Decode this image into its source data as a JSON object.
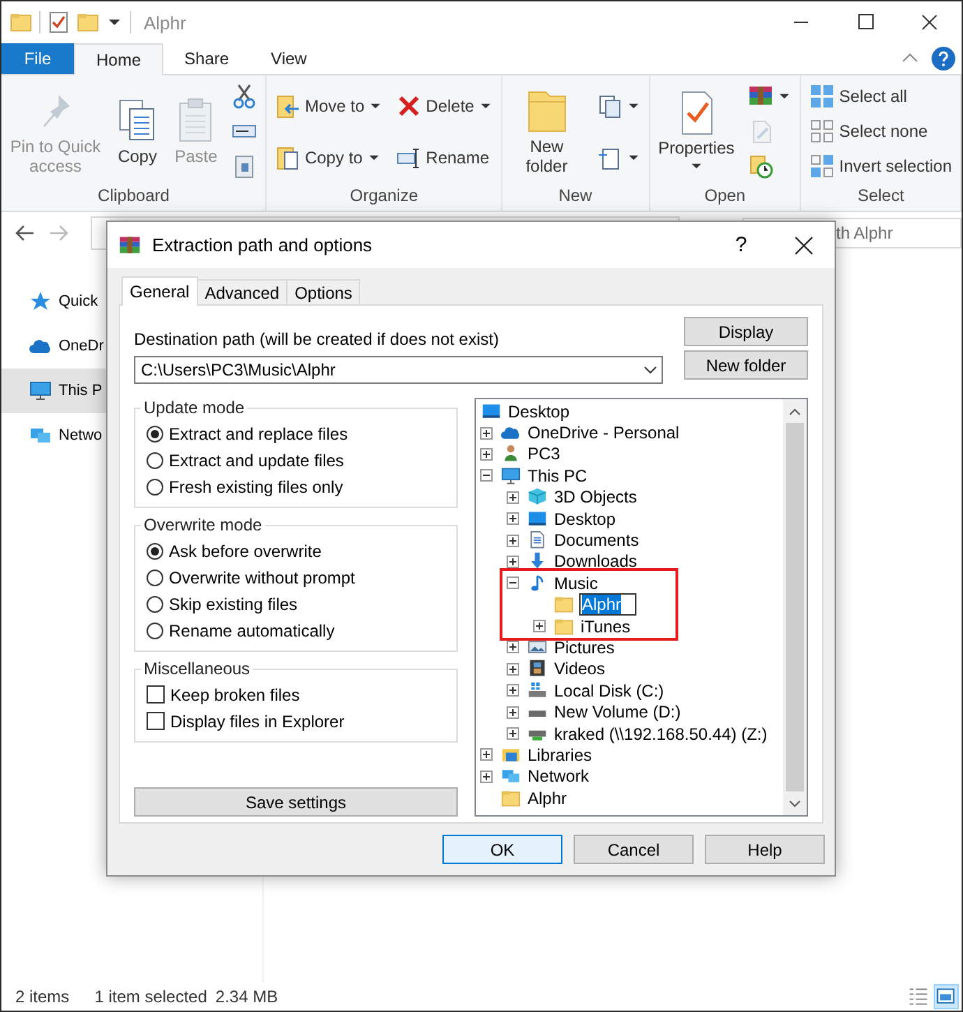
{
  "window": {
    "title": "Alphr"
  },
  "ribbon_tabs": [
    {
      "label": "File",
      "kind": "file",
      "selected": false
    },
    {
      "label": "Home",
      "kind": "tab",
      "selected": true
    },
    {
      "label": "Share",
      "kind": "tab",
      "selected": false
    },
    {
      "label": "View",
      "kind": "tab",
      "selected": false
    }
  ],
  "ribbon_groups": [
    {
      "label": "Clipboard",
      "columns": [
        [
          {
            "label": "Pin to Quick access",
            "kind": "pin",
            "disabled": true,
            "dropdown": false
          }
        ],
        [
          {
            "label": "Copy",
            "kind": "copy",
            "disabled": false,
            "dropdown": false
          }
        ],
        [
          {
            "label": "Paste",
            "kind": "paste",
            "disabled": true,
            "dropdown": false
          }
        ],
        [
          {
            "kind": "cut",
            "disabled": false,
            "dropdown": false
          },
          {
            "kind": "copy-path",
            "disabled": false,
            "dropdown": false
          },
          {
            "kind": "paste-shortcut",
            "disabled": false,
            "dropdown": false
          }
        ]
      ]
    },
    {
      "label": "Organize",
      "columns": [
        [
          {
            "label": "Move to",
            "kind": "move-to",
            "disabled": false,
            "dropdown": true
          },
          {
            "label": "Copy to",
            "kind": "copy-to",
            "disabled": false,
            "dropdown": true
          }
        ],
        [
          {
            "label": "Delete",
            "kind": "delete",
            "disabled": false,
            "dropdown": true
          },
          {
            "label": "Rename",
            "kind": "rename",
            "disabled": false,
            "dropdown": false
          }
        ]
      ]
    },
    {
      "label": "New",
      "columns": [
        [
          {
            "label": "New folder",
            "kind": "new-folder",
            "disabled": false,
            "dropdown": false
          }
        ],
        [
          {
            "kind": "new-item",
            "disabled": false,
            "dropdown": true
          },
          {
            "kind": "easy-access",
            "disabled": false,
            "dropdown": true
          }
        ]
      ]
    },
    {
      "label": "Open",
      "columns": [
        [
          {
            "label": "Properties",
            "kind": "properties",
            "disabled": false,
            "dropdown": true
          }
        ],
        [
          {
            "kind": "winrar",
            "disabled": false,
            "dropdown": true
          },
          {
            "kind": "edit",
            "disabled": true,
            "dropdown": false
          },
          {
            "kind": "history",
            "disabled": false,
            "dropdown": false
          }
        ]
      ]
    },
    {
      "label": "Select",
      "columns": [
        [
          {
            "label": "Select all",
            "kind": "select-all",
            "disabled": false,
            "dropdown": false
          },
          {
            "label": "Select none",
            "kind": "select-none",
            "disabled": false,
            "dropdown": false
          },
          {
            "label": "Invert selection",
            "kind": "invert",
            "disabled": false,
            "dropdown": false
          }
        ]
      ]
    }
  ],
  "search": {
    "placeholder": "th Alphr"
  },
  "nav_items": [
    {
      "label": "Quick",
      "kind": "star",
      "selected": false
    },
    {
      "label": "OneDr",
      "kind": "cloud",
      "selected": false
    },
    {
      "label": "This P",
      "kind": "pc",
      "selected": true
    },
    {
      "label": "Netwo",
      "kind": "network",
      "selected": false
    }
  ],
  "status_bar": {
    "items": "2 items",
    "selection": "1 item selected",
    "size": "2.34 MB",
    "view_buttons": [
      {
        "kind": "details",
        "selected": false
      },
      {
        "kind": "tiles",
        "selected": true
      }
    ]
  },
  "dialog": {
    "title": "Extraction path and options",
    "help": "?",
    "tabs": [
      {
        "label": "General",
        "selected": true
      },
      {
        "label": "Advanced",
        "selected": false
      },
      {
        "label": "Options",
        "selected": false
      }
    ],
    "destination": {
      "label": "Destination path (will be created if does not exist)",
      "value": "C:\\Users\\PC3\\Music\\Alphr"
    },
    "side_buttons": [
      "Display",
      "New folder"
    ],
    "groups": [
      {
        "title": "Update mode",
        "options": [
          {
            "label": "Extract and replace files",
            "kind": "radio",
            "checked": true
          },
          {
            "label": "Extract and update files",
            "kind": "radio",
            "checked": false
          },
          {
            "label": "Fresh existing files only",
            "kind": "radio",
            "checked": false
          }
        ]
      },
      {
        "title": "Overwrite mode",
        "options": [
          {
            "label": "Ask before overwrite",
            "kind": "radio",
            "checked": true
          },
          {
            "label": "Overwrite without prompt",
            "kind": "radio",
            "checked": false
          },
          {
            "label": "Skip existing files",
            "kind": "radio",
            "checked": false
          },
          {
            "label": "Rename automatically",
            "kind": "radio",
            "checked": false
          }
        ]
      },
      {
        "title": "Miscellaneous",
        "options": [
          {
            "label": "Keep broken files",
            "kind": "checkbox",
            "checked": false
          },
          {
            "label": "Display files in Explorer",
            "kind": "checkbox",
            "checked": false
          }
        ]
      }
    ],
    "save_button": "Save settings",
    "tree": [
      {
        "label": "Desktop",
        "kind": "desktop",
        "expander": false,
        "children": [
          {
            "label": "OneDrive - Personal",
            "kind": "cloud",
            "expander": true
          },
          {
            "label": "PC3",
            "kind": "user",
            "expander": true
          },
          {
            "label": "This PC",
            "kind": "pc",
            "expander": true,
            "expanded": true,
            "children": [
              {
                "label": "3D Objects",
                "kind": "cube",
                "expander": true
              },
              {
                "label": "Desktop",
                "kind": "desktop",
                "expander": true
              },
              {
                "label": "Documents",
                "kind": "documents",
                "expander": true
              },
              {
                "label": "Downloads",
                "kind": "download",
                "expander": true
              },
              {
                "label": "Music",
                "kind": "music",
                "expander": true,
                "expanded": true,
                "highlighted": true,
                "children": [
                  {
                    "label": "Alphr",
                    "kind": "folder",
                    "expander": false,
                    "editing": true
                  },
                  {
                    "label": "iTunes",
                    "kind": "folder",
                    "expander": true
                  }
                ]
              },
              {
                "label": "Pictures",
                "kind": "pictures",
                "expander": true
              },
              {
                "label": "Videos",
                "kind": "videos",
                "expander": true
              },
              {
                "label": "Local Disk (C:)",
                "kind": "disk",
                "expander": true
              },
              {
                "label": "New Volume (D:)",
                "kind": "drive",
                "expander": true
              },
              {
                "label": "kraked (\\\\192.168.50.44) (Z:)",
                "kind": "netdrive",
                "expander": true
              }
            ]
          },
          {
            "label": "Libraries",
            "kind": "libraries",
            "expander": true
          },
          {
            "label": "Network",
            "kind": "network",
            "expander": true
          },
          {
            "label": "Alphr",
            "kind": "folder",
            "expander": false
          }
        ]
      }
    ],
    "footer_buttons": [
      {
        "label": "OK",
        "default": true
      },
      {
        "label": "Cancel",
        "default": false
      },
      {
        "label": "Help",
        "default": false
      }
    ]
  }
}
